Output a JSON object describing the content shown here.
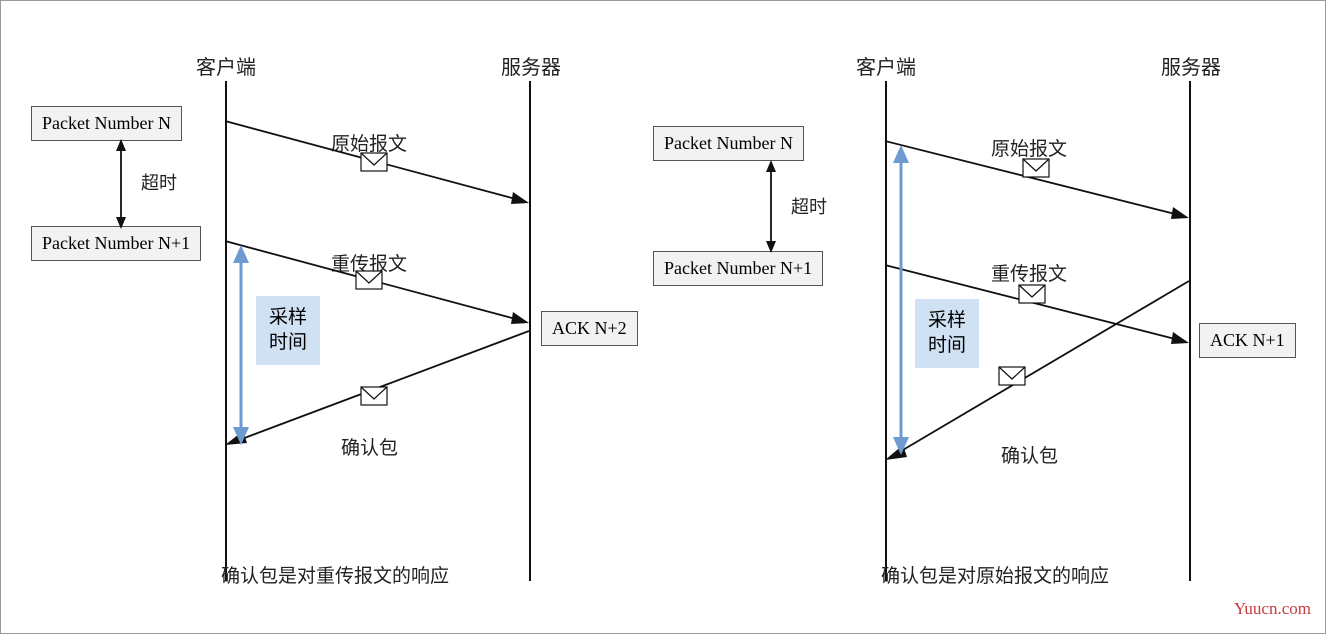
{
  "labels": {
    "client": "客户端",
    "server": "服务器",
    "timeout": "超时",
    "sample_time_l1": "采样",
    "sample_time_l2": "时间",
    "orig_msg": "原始报文",
    "retry_msg": "重传报文",
    "ack_msg": "确认包"
  },
  "packets": {
    "pkt_n": "Packet Number N",
    "pkt_n1": "Packet Number N+1",
    "ack_n2": "ACK N+2",
    "ack_n1": "ACK N+1"
  },
  "captions": {
    "left": "确认包是对重传报文的响应",
    "right": "确认包是对原始报文的响应"
  },
  "watermark": "Yuucn.com"
}
